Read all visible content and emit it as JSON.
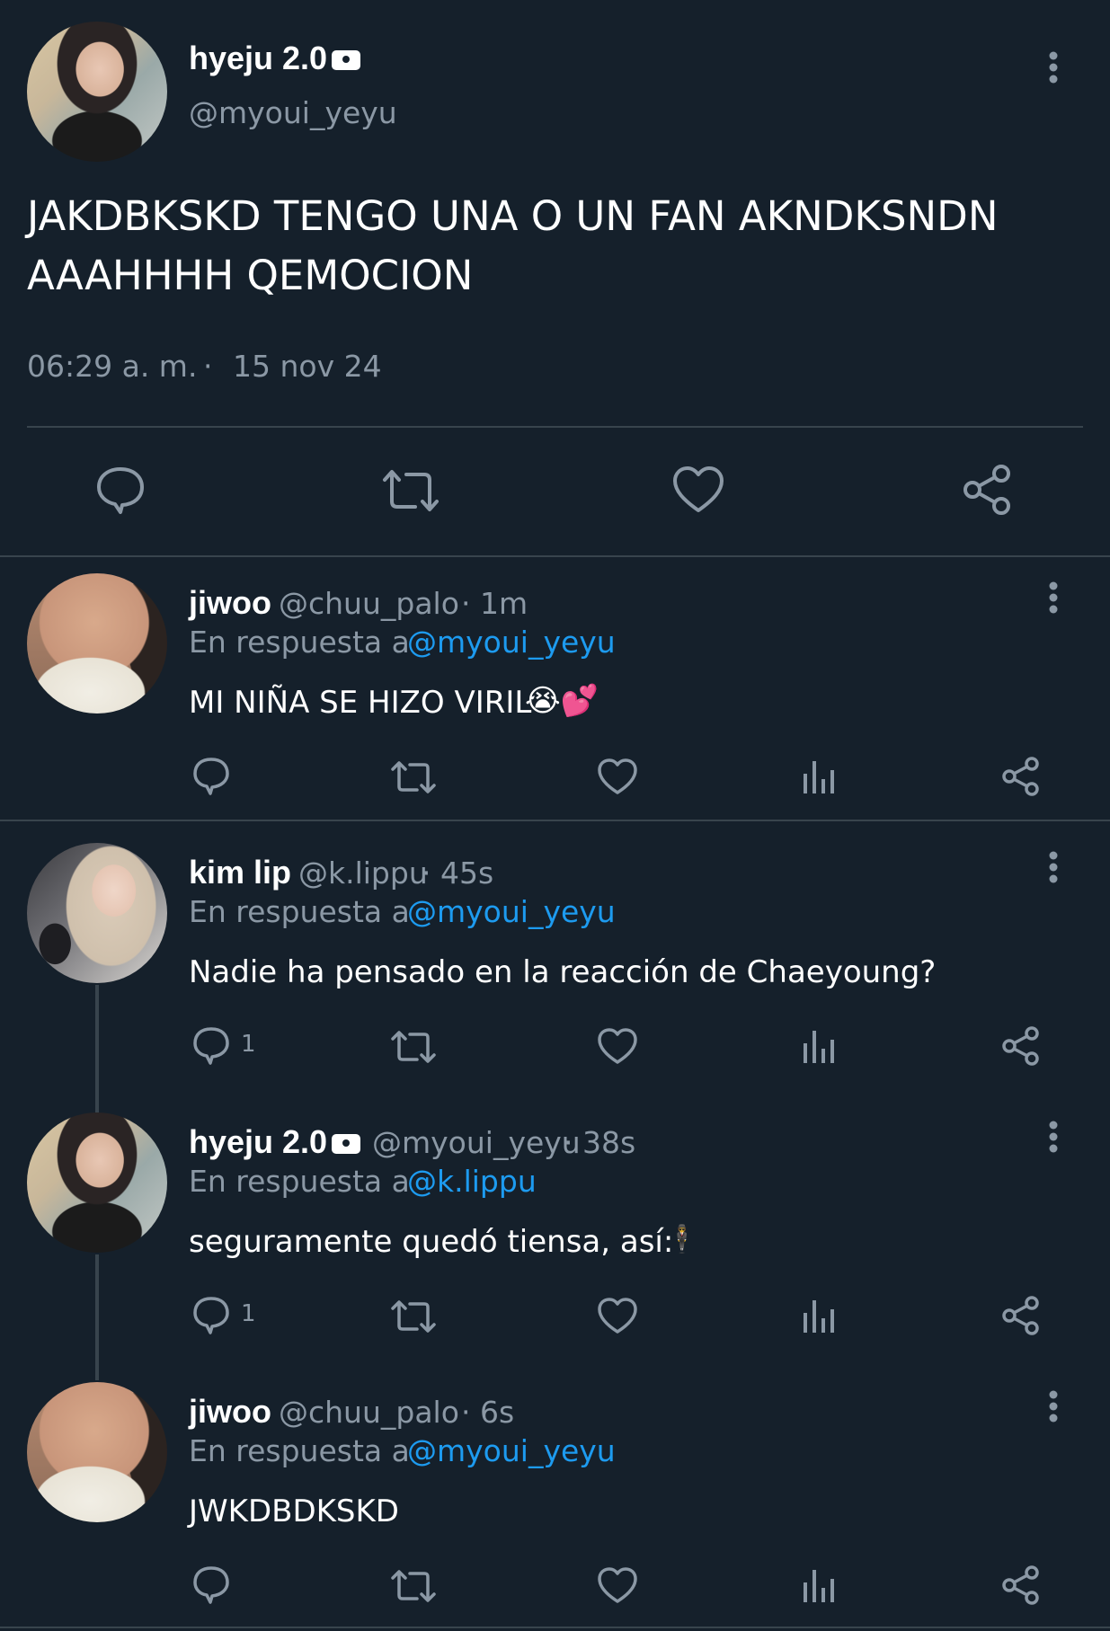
{
  "main_tweet": {
    "display_name": "hyeju 2.0",
    "handle": "@myoui_yeyu",
    "protected": true,
    "text_line1": "JAKDBKSKD TENGO UNA O UN FAN AKNDKSNDN",
    "text_line2": "AAAHHHH QEMOCION",
    "time": "06:29 a. m.",
    "separator": "·",
    "date": "15 nov 24",
    "actions": [
      "reply-icon",
      "retweet-icon",
      "like-icon",
      "share-icon"
    ]
  },
  "replies": [
    {
      "display_name": "jiwoo",
      "handle": "@chuu_palo",
      "time": "· 1m",
      "reply_prefix": "En respuesta a",
      "reply_to": "@myoui_yeyu",
      "text": "MI NIÑA SE HIZO VIRIL",
      "emoji": "😭💕",
      "reply_count": ""
    },
    {
      "display_name": "kim lip",
      "handle": "@k.lippu",
      "time": "· 45s",
      "reply_prefix": "En respuesta a",
      "reply_to": "@myoui_yeyu",
      "text": "Nadie ha pensado en la reacción de Chaeyoung?",
      "emoji": "",
      "reply_count": "1"
    },
    {
      "display_name": "hyeju 2.0",
      "handle": "@myoui_yeyu",
      "time": "· 38s",
      "protected": true,
      "reply_prefix": "En respuesta a",
      "reply_to": "@k.lippu",
      "text": "seguramente quedó tiensa, así:",
      "emoji": "🕴",
      "reply_count": "1"
    },
    {
      "display_name": "jiwoo",
      "handle": "@chuu_palo",
      "time": "· 6s",
      "reply_prefix": "En respuesta a",
      "reply_to": "@myoui_yeyu",
      "text": "JWKDBDKSKD",
      "emoji": "",
      "reply_count": ""
    }
  ],
  "colors": {
    "background": "#15202b",
    "text": "#ffffff",
    "muted": "#8b98a5",
    "link": "#1d9bf0",
    "divider": "#38444d"
  }
}
